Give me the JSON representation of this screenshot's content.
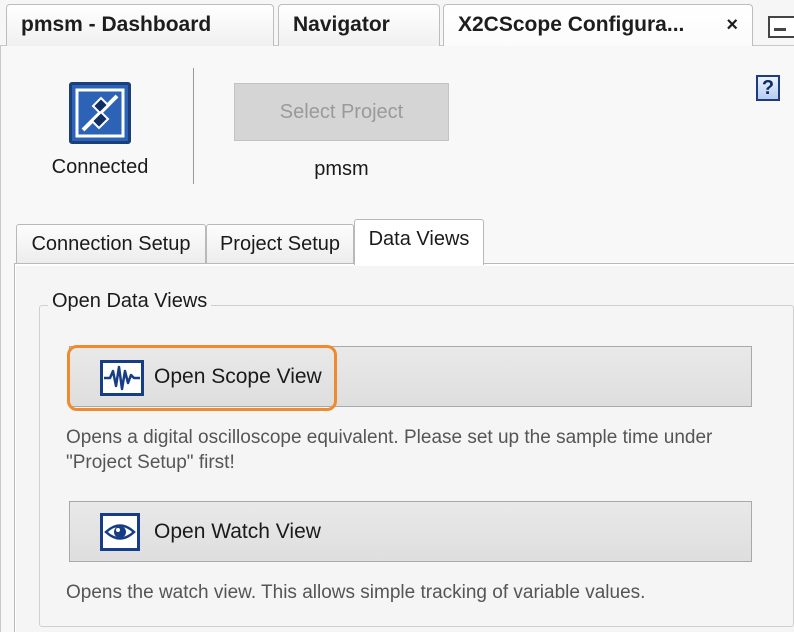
{
  "window_tabs": [
    {
      "label": "pmsm - Dashboard"
    },
    {
      "label": "Navigator"
    },
    {
      "label": "X2CScope Configura...",
      "close": "×",
      "active": true
    }
  ],
  "header": {
    "connection_status": "Connected",
    "select_project_label": "Select Project",
    "project_name": "pmsm",
    "help_label": "?"
  },
  "sub_tabs": [
    {
      "label": "Connection Setup"
    },
    {
      "label": "Project Setup"
    },
    {
      "label": "Data Views",
      "active": true
    }
  ],
  "data_views": {
    "group_title": "Open Data Views",
    "scope_button_label": "Open Scope View",
    "scope_description": "Opens a digital oscilloscope equivalent. Please set up the sample time under \"Project Setup\" first!",
    "watch_button_label": "Open Watch View",
    "watch_description": "Opens the watch view. This allows simple tracking of variable values."
  },
  "icons": {
    "connected": "plug-connected-icon",
    "scope": "waveform-icon",
    "watch": "eye-icon",
    "help": "help-icon"
  },
  "colors": {
    "accent_blue": "#173d86",
    "icon_blue": "#2c63b7",
    "highlight_orange": "#ef8b2e",
    "disabled_button": "#d5d5d5"
  }
}
